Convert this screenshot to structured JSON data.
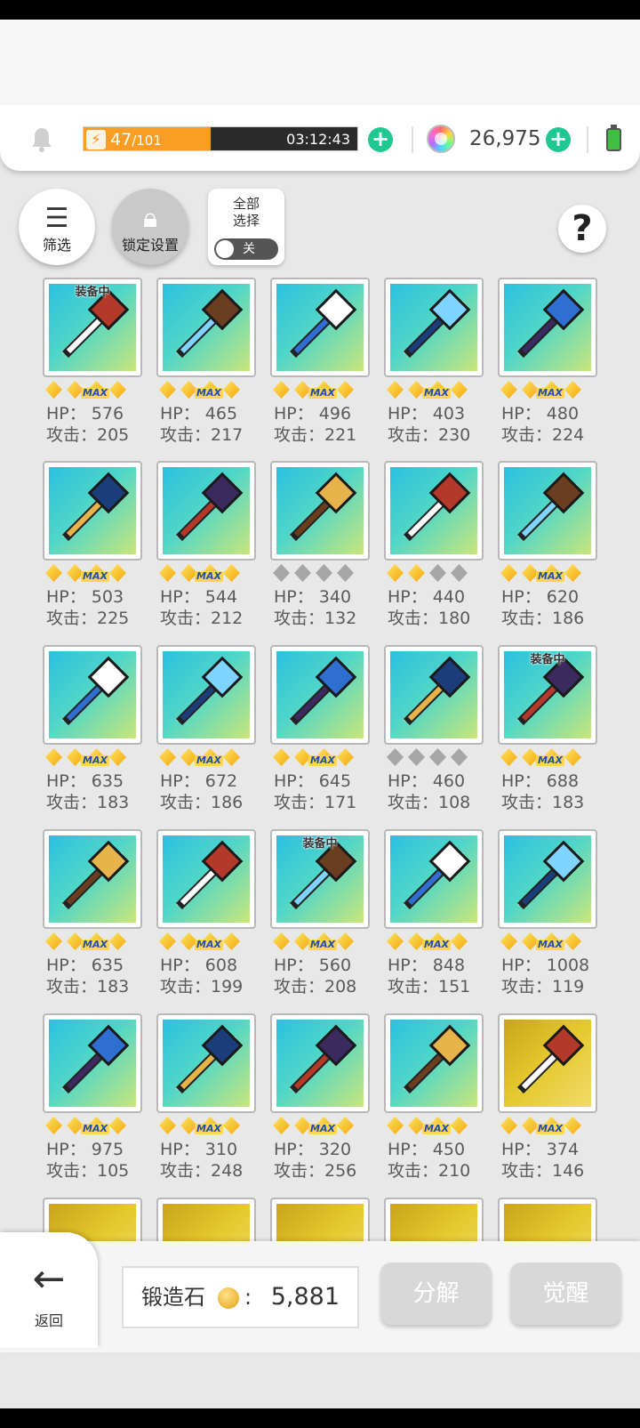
{
  "status": {
    "energy_current": "47",
    "energy_max": "/101",
    "energy_progress": 0.465,
    "energy_timer": "03:12:43",
    "gems": "26,975"
  },
  "toolbar": {
    "filter_label": "筛选",
    "lock_label": "锁定设置",
    "select_all_label": "全部\n选择",
    "toggle_state": "关",
    "help_label": "?"
  },
  "equipped_label": "装备中",
  "max_label": "MAX",
  "items": [
    {
      "hp": "HP： 576",
      "atk": "攻击：205",
      "stars": "max",
      "equipped": true,
      "bg": "teal",
      "weapon": "scythe"
    },
    {
      "hp": "HP： 465",
      "atk": "攻击：217",
      "stars": "max",
      "equipped": false,
      "bg": "teal",
      "weapon": "curved-blade"
    },
    {
      "hp": "HP： 496",
      "atk": "攻击：221",
      "stars": "max",
      "equipped": false,
      "bg": "teal",
      "weapon": "crystal-fan"
    },
    {
      "hp": "HP： 403",
      "atk": "攻击：230",
      "stars": "max",
      "equipped": false,
      "bg": "teal",
      "weapon": "broadsword"
    },
    {
      "hp": "HP： 480",
      "atk": "攻击：224",
      "stars": "max",
      "equipped": false,
      "bg": "teal",
      "weapon": "battle-axe"
    },
    {
      "hp": "HP： 503",
      "atk": "攻击：225",
      "stars": "max",
      "equipped": false,
      "bg": "teal",
      "weapon": "hammer"
    },
    {
      "hp": "HP： 544",
      "atk": "攻击：212",
      "stars": "max",
      "equipped": false,
      "bg": "teal",
      "weapon": "spear"
    },
    {
      "hp": "HP： 340",
      "atk": "攻击：132",
      "stars": "gray",
      "equipped": false,
      "bg": "teal",
      "weapon": "staff"
    },
    {
      "hp": "HP： 440",
      "atk": "攻击：180",
      "stars": "half",
      "equipped": false,
      "bg": "teal",
      "weapon": "trident"
    },
    {
      "hp": "HP： 620",
      "atk": "攻击：186",
      "stars": "max",
      "equipped": false,
      "bg": "teal",
      "weapon": "halberd"
    },
    {
      "hp": "HP： 635",
      "atk": "攻击：183",
      "stars": "max",
      "equipped": false,
      "bg": "teal",
      "weapon": "spellbook"
    },
    {
      "hp": "HP： 672",
      "atk": "攻击：186",
      "stars": "max",
      "equipped": false,
      "bg": "teal",
      "weapon": "tome"
    },
    {
      "hp": "HP： 645",
      "atk": "攻击：171",
      "stars": "max",
      "equipped": false,
      "bg": "teal",
      "weapon": "wand"
    },
    {
      "hp": "HP： 460",
      "atk": "攻击：108",
      "stars": "gray",
      "equipped": false,
      "bg": "teal",
      "weapon": "orb-staff"
    },
    {
      "hp": "HP： 688",
      "atk": "攻击：183",
      "stars": "max",
      "equipped": true,
      "bg": "teal",
      "weapon": "fish"
    },
    {
      "hp": "HP： 635",
      "atk": "攻击：183",
      "stars": "max",
      "equipped": false,
      "bg": "teal",
      "weapon": "gauntlet"
    },
    {
      "hp": "HP： 608",
      "atk": "攻击：199",
      "stars": "max",
      "equipped": false,
      "bg": "teal",
      "weapon": "shark"
    },
    {
      "hp": "HP： 560",
      "atk": "攻击：208",
      "stars": "max",
      "equipped": true,
      "bg": "teal",
      "weapon": "armor"
    },
    {
      "hp": "HP： 848",
      "atk": "攻击：151",
      "stars": "max",
      "equipped": false,
      "bg": "teal",
      "weapon": "shield"
    },
    {
      "hp": "HP： 1008",
      "atk": "攻击：119",
      "stars": "max",
      "equipped": false,
      "bg": "teal",
      "weapon": "mushroom"
    },
    {
      "hp": "HP： 975",
      "atk": "攻击：105",
      "stars": "max",
      "equipped": false,
      "bg": "teal",
      "weapon": "claws"
    },
    {
      "hp": "HP： 310",
      "atk": "攻击：248",
      "stars": "max",
      "equipped": false,
      "bg": "teal",
      "weapon": "rocket-launcher"
    },
    {
      "hp": "HP： 320",
      "atk": "攻击：256",
      "stars": "max",
      "equipped": false,
      "bg": "teal",
      "weapon": "rifle"
    },
    {
      "hp": "HP： 450",
      "atk": "攻击：210",
      "stars": "max",
      "equipped": false,
      "bg": "teal",
      "weapon": "bow"
    },
    {
      "hp": "HP： 374",
      "atk": "攻击：146",
      "stars": "max",
      "equipped": false,
      "bg": "gold",
      "weapon": "fire-sword"
    },
    {
      "hp": "",
      "atk": "",
      "stars": "none",
      "equipped": false,
      "bg": "gold",
      "weapon": "partial"
    },
    {
      "hp": "",
      "atk": "",
      "stars": "none",
      "equipped": false,
      "bg": "gold",
      "weapon": "partial"
    },
    {
      "hp": "",
      "atk": "",
      "stars": "none",
      "equipped": false,
      "bg": "gold",
      "weapon": "partial"
    },
    {
      "hp": "",
      "atk": "",
      "stars": "none",
      "equipped": false,
      "bg": "gold",
      "weapon": "partial"
    },
    {
      "hp": "",
      "atk": "",
      "stars": "none",
      "equipped": false,
      "bg": "gold",
      "weapon": "partial"
    }
  ],
  "bottom": {
    "back_label": "返回",
    "stone_label": "锻造石",
    "stone_colon": ":",
    "stone_count": "5,881",
    "decompose_label": "分解",
    "awaken_label": "觉醒"
  },
  "colors": {
    "energy_fill": "#f99d25",
    "plus_button": "#1fc98e",
    "card_teal": "#2bc0e0",
    "card_gold": "#e6c92f",
    "disabled_button": "#d8d8d8"
  }
}
